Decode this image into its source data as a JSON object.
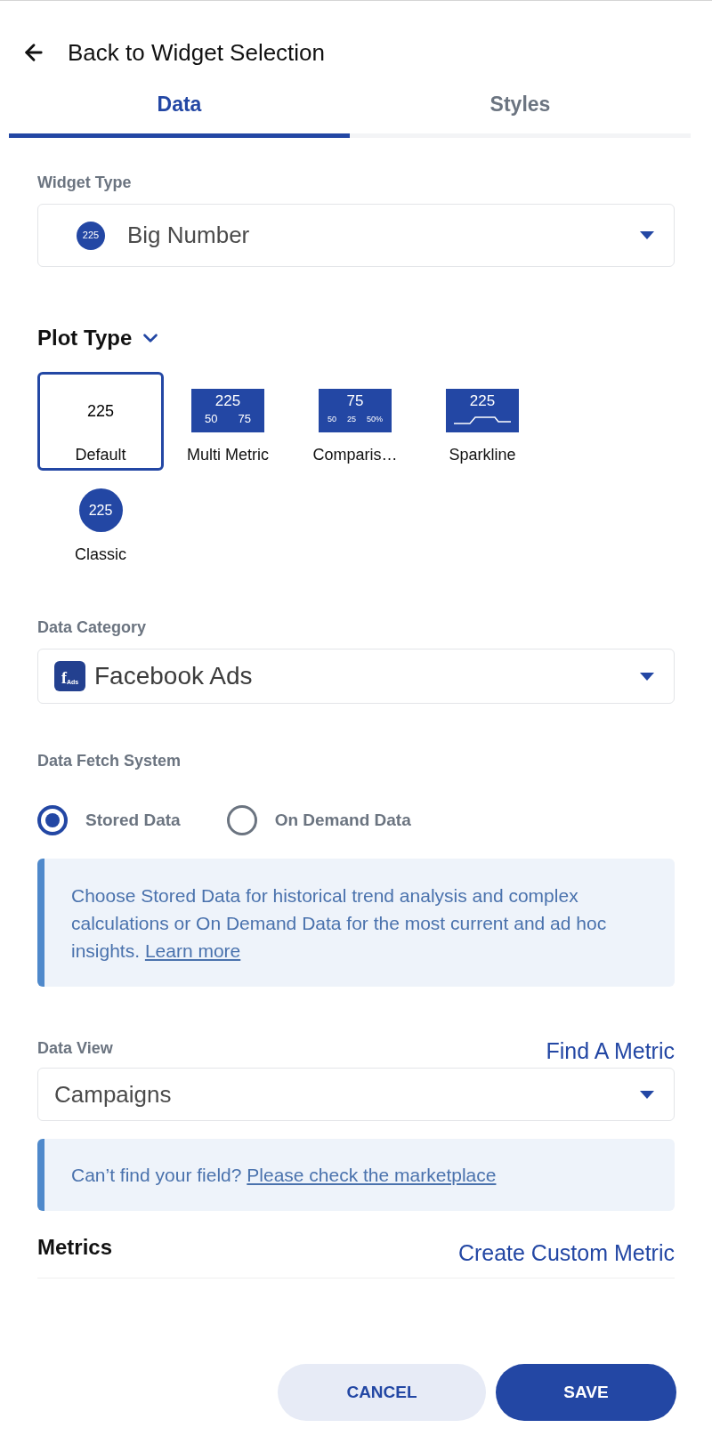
{
  "header": {
    "back_label": "Back to Widget Selection"
  },
  "tabs": [
    {
      "label": "Data",
      "selected": true
    },
    {
      "label": "Styles",
      "selected": false
    }
  ],
  "widget_type": {
    "label": "Widget Type",
    "badge": "225",
    "value": "Big Number"
  },
  "plot_type": {
    "title": "Plot Type",
    "expanded": true,
    "options": [
      {
        "kind": "default",
        "label": "Default",
        "selected": true,
        "numbers": [
          "225"
        ]
      },
      {
        "kind": "multi",
        "label": "Multi Metric",
        "selected": false,
        "numbers": [
          "225",
          "50",
          "75"
        ]
      },
      {
        "kind": "comparison",
        "label": "Comparis…",
        "selected": false,
        "numbers": [
          "75",
          "50",
          "25",
          "50%"
        ]
      },
      {
        "kind": "sparkline",
        "label": "Sparkline",
        "selected": false,
        "numbers": [
          "225"
        ]
      },
      {
        "kind": "classic",
        "label": "Classic",
        "selected": false,
        "numbers": [
          "225"
        ]
      }
    ]
  },
  "data_category": {
    "label": "Data Category",
    "logo_text": "f",
    "logo_subtext": "Ads",
    "value": "Facebook Ads"
  },
  "data_fetch": {
    "label": "Data Fetch System",
    "options": [
      {
        "label": "Stored Data",
        "selected": true
      },
      {
        "label": "On Demand Data",
        "selected": false
      }
    ],
    "note": {
      "text": "Choose Stored Data for historical trend analysis and complex calculations or On Demand Data for the most current and ad hoc insights.",
      "link": "Learn more"
    }
  },
  "data_view": {
    "label": "Data View",
    "action": "Find A Metric",
    "value": "Campaigns",
    "note": {
      "text": "Can’t find your field?",
      "link": "Please check the marketplace"
    }
  },
  "metrics": {
    "title": "Metrics",
    "action": "Create Custom Metric"
  },
  "buttons": [
    {
      "kind": "secondary",
      "label": "CANCEL"
    },
    {
      "kind": "primary",
      "label": "SAVE"
    }
  ]
}
